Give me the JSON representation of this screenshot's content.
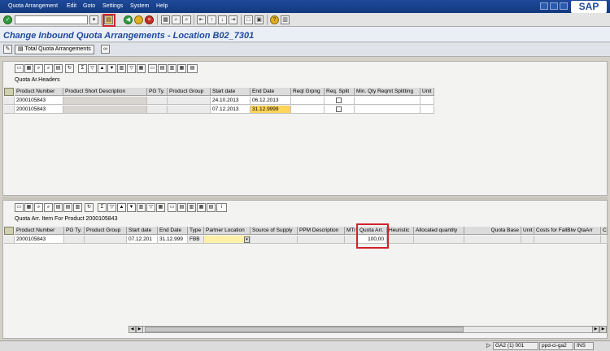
{
  "menu": [
    "Quota Arrangement",
    "Edit",
    "Goto",
    "Settings",
    "System",
    "Help"
  ],
  "brand": "SAP",
  "title": "Change Inbound Quota Arrangements - Location B02_7301",
  "app_toolbar": {
    "total_button": "Total Quota Arrangements"
  },
  "headers_grid": {
    "caption": "Quota Ar.Headers",
    "columns": [
      "Product Number",
      "Product Short Description",
      "PG Ty.",
      "Product Group",
      "Start date",
      "End Date",
      "Reqt Grpng",
      "Req. Split",
      "Min. Qty Reqmt Splitting",
      "Unit"
    ],
    "rows": [
      {
        "product": "2000105843",
        "start": "24.10.2013",
        "end": "06.12.2013"
      },
      {
        "product": "2000105843",
        "start": "07.12.2013",
        "end": "31.12.9999"
      }
    ]
  },
  "items_grid": {
    "caption": "Quota Arr. Item For Product 2000105843",
    "columns": [
      "Product Number",
      "PG Ty.",
      "Product Group",
      "Start date",
      "End Date",
      "Type",
      "Partner Location",
      "Source of Supply",
      "PPM Description",
      "MTr",
      "Quota Arr.",
      "Heuristic",
      "Allocated quantity",
      "Quota Base",
      "Unit",
      "Costs for FallBlw QtaArr",
      "C"
    ],
    "rows": [
      {
        "product": "2000105843",
        "start": "07.12.201",
        "end": "31.12.999",
        "type": "FBB",
        "quota": "100,00"
      }
    ]
  },
  "status": {
    "system": "GA2 (1) 001",
    "server": "ppd-ci-ga2",
    "mode": "INS"
  }
}
